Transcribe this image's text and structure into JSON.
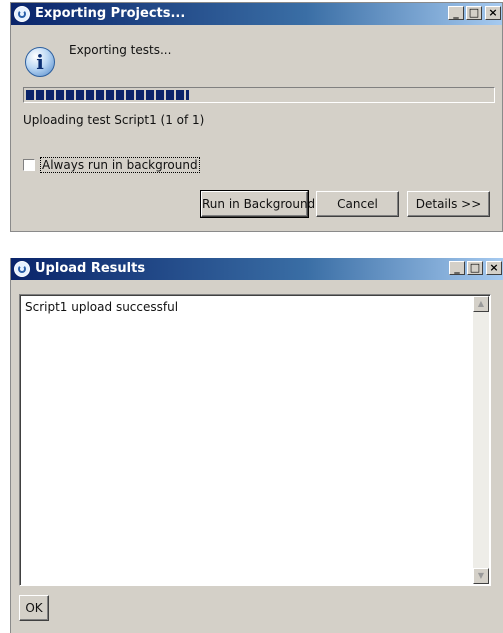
{
  "export_dialog": {
    "title": "Exporting Projects...",
    "message": "Exporting tests...",
    "progress_fraction": 0.35,
    "status_text": "Uploading test Script1 (1 of 1)",
    "checkbox_label": "Always run in background",
    "checkbox_checked": false,
    "buttons": {
      "run_in_background": "Run in Background",
      "cancel": "Cancel",
      "details": "Details >>"
    }
  },
  "upload_dialog": {
    "title": "Upload Results",
    "result_text": "Script1 upload successful",
    "ok_label": "OK"
  },
  "window_controls": {
    "minimize": "_",
    "maximize": "□",
    "close": "×"
  },
  "colors": {
    "titlebar": "#0a246a",
    "dialog_face": "#d4d0c8",
    "progress": "#0a246a"
  }
}
